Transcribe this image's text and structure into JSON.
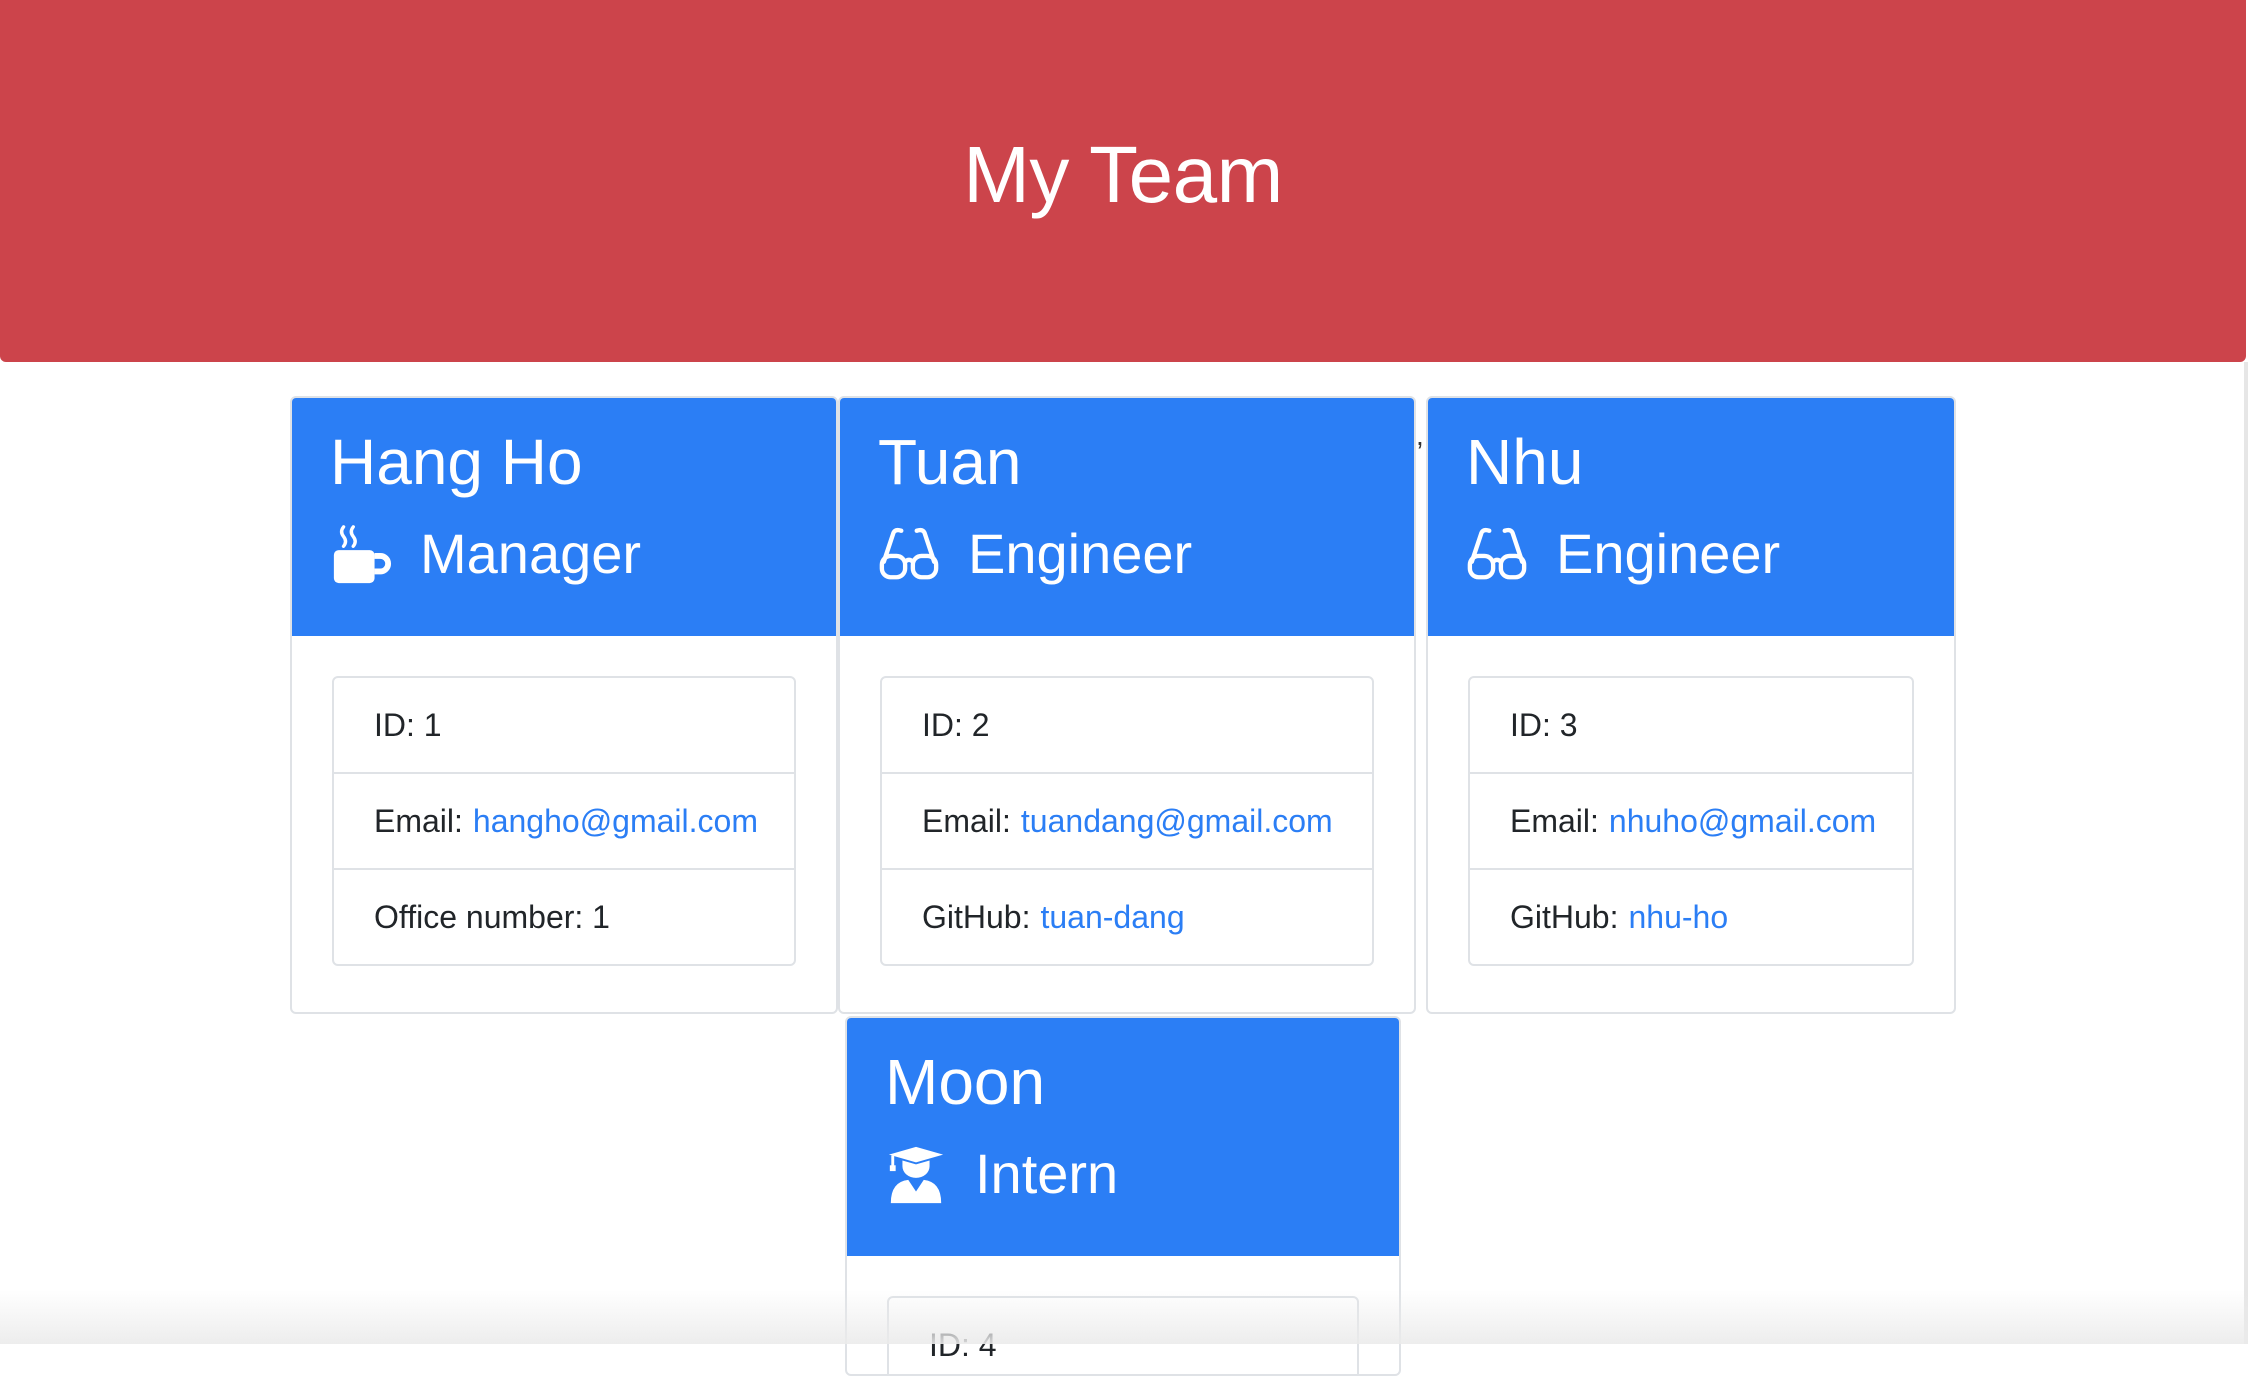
{
  "header": {
    "title": "My Team"
  },
  "colors": {
    "header_bg": "#cc444b",
    "card_header_bg": "#2b7ef5",
    "link": "#2b7ef5"
  },
  "employees": [
    {
      "name": "Hang Ho",
      "role": "Manager",
      "icon": "coffee-mug-icon",
      "id_text": "ID: 1",
      "email_label": "Email:",
      "email": "hangho@gmail.com",
      "extra_label": "Office number: 1",
      "extra_link": ""
    },
    {
      "name": "Tuan",
      "role": "Engineer",
      "icon": "glasses-icon",
      "id_text": "ID: 2",
      "email_label": "Email:",
      "email": "tuandang@gmail.com",
      "extra_label": "GitHub:",
      "extra_link": "tuan-dang"
    },
    {
      "name": "Nhu",
      "role": "Engineer",
      "icon": "glasses-icon",
      "id_text": "ID: 3",
      "email_label": "Email:",
      "email": "nhuho@gmail.com",
      "extra_label": "GitHub:",
      "extra_link": "nhu-ho"
    },
    {
      "name": "Moon",
      "role": "Intern",
      "icon": "graduate-icon",
      "id_text": "ID: 4"
    }
  ],
  "stray_mark": ","
}
